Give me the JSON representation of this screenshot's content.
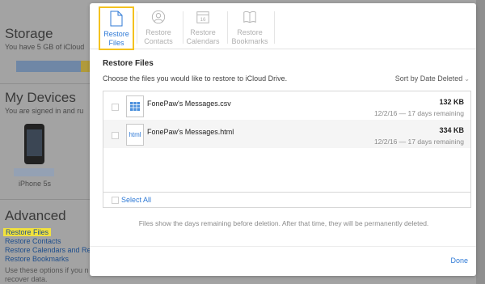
{
  "background": {
    "storage": {
      "heading": "Storage",
      "subtitle": "You have 5 GB of iCloud"
    },
    "devices": {
      "heading": "My Devices",
      "subtitle": "You are signed in and ru",
      "device_name": "iPhone 5s"
    },
    "advanced": {
      "heading": "Advanced",
      "links": [
        "Restore Files",
        "Restore Contacts",
        "Restore Calendars and Re",
        "Restore Bookmarks"
      ],
      "note_line1": "Use these options if you n",
      "note_line2": "recover data."
    }
  },
  "modal": {
    "tabs": [
      {
        "label": "Restore\nFiles",
        "icon": "document-icon",
        "active": true
      },
      {
        "label": "Restore\nContacts",
        "icon": "contact-icon",
        "active": false
      },
      {
        "label": "Restore\nCalendars",
        "icon": "calendar-icon",
        "active": false
      },
      {
        "label": "Restore\nBookmarks",
        "icon": "book-icon",
        "active": false
      }
    ],
    "title": "Restore Files",
    "instructions": "Choose the files you would like to restore to iCloud Drive.",
    "sort_label": "Sort by Date Deleted",
    "files": [
      {
        "name": "FonePaw's Messages.csv",
        "size": "132 KB",
        "meta": "12/2/16 — 17 days remaining",
        "icon": "spreadsheet-file-icon"
      },
      {
        "name": "FonePaw's Messages.html",
        "size": "334 KB",
        "meta": "12/2/16 — 17 days remaining",
        "icon": "html-file-icon",
        "icon_text": "html"
      }
    ],
    "select_all": "Select All",
    "note": "Files show the days remaining before deletion. After that time, they will be permanently deleted.",
    "done": "Done"
  },
  "colors": {
    "accent": "#2f7ad6",
    "highlight": "#f4c21f"
  }
}
